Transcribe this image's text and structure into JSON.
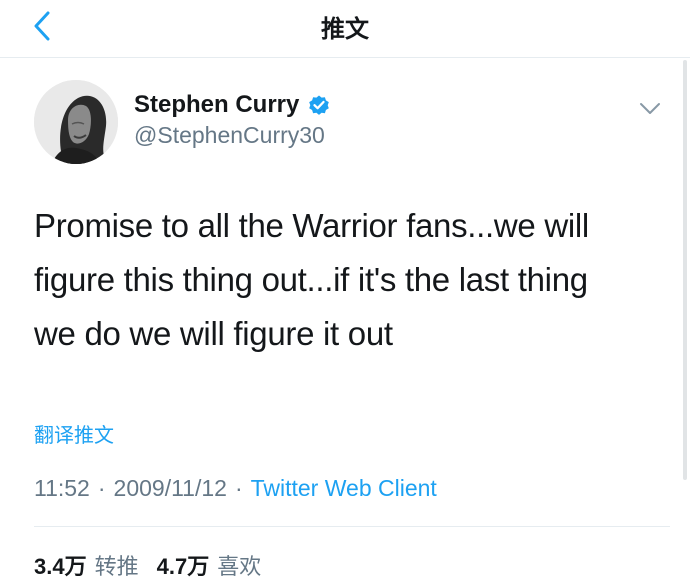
{
  "nav": {
    "title": "推文"
  },
  "tweet": {
    "author_name": "Stephen Curry",
    "author_handle": "@StephenCurry30",
    "verified": true,
    "text_lines": [
      "Promise to all the Warrior fans...we will",
      "figure this thing out...if it's the last thing",
      "we do we will figure it out"
    ],
    "translate_label": "翻译推文",
    "time": "11:52",
    "date": "2009/11/12",
    "separator": "·",
    "source": "Twitter Web Client"
  },
  "stats": {
    "retweets_count": "3.4万",
    "retweets_label": "转推",
    "likes_count": "4.7万",
    "likes_label": "喜欢"
  },
  "colors": {
    "accent": "#1da1f2",
    "text_primary": "#14171a",
    "text_secondary": "#657786",
    "divider": "#e6ecf0"
  },
  "icons": {
    "back": "chevron-left-icon",
    "verified": "verified-badge-icon",
    "more": "chevron-down-icon"
  }
}
